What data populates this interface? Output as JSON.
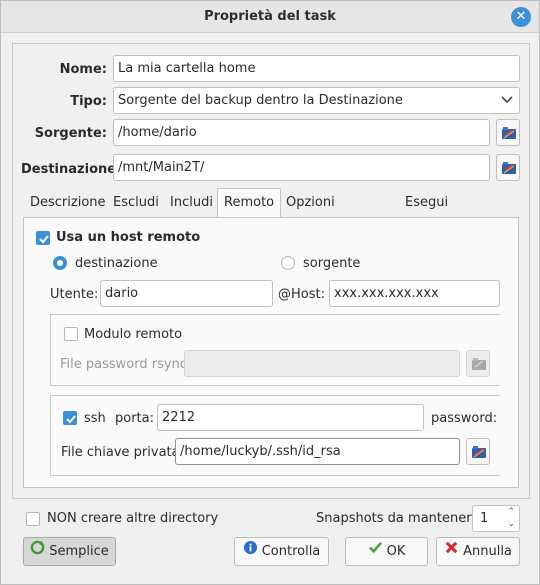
{
  "window": {
    "title": "Proprietà del task"
  },
  "form": {
    "name_label": "Nome:",
    "name_value": "La mia cartella home",
    "type_label": "Tipo:",
    "type_value": "Sorgente del backup dentro la Destinazione",
    "source_label": "Sorgente:",
    "source_value": "/home/dario",
    "dest_label": "Destinazione:",
    "dest_value": "/mnt/Main2T/"
  },
  "tabs": [
    {
      "label": "Descrizione",
      "active": false
    },
    {
      "label": "Escludi",
      "active": false
    },
    {
      "label": "Includi",
      "active": false
    },
    {
      "label": "Remoto",
      "active": true
    },
    {
      "label": "Opzioni comando",
      "active": false
    },
    {
      "label": "Esegui comandi",
      "active": false
    }
  ],
  "remote": {
    "use_remote_label": "Usa un host remoto",
    "use_remote_checked": true,
    "dest_radio_label": "destinazione",
    "source_radio_label": "sorgente",
    "selected_radio": "destinazione",
    "user_label": "Utente:",
    "user_value": "dario",
    "host_label": "@Host:",
    "host_value": "xxx.xxx.xxx.xxx",
    "module_label": "Modulo remoto",
    "module_checked": false,
    "rsync_pw_label": "File password rsync:",
    "rsync_pw_value": "",
    "ssh_label": "ssh",
    "ssh_checked": true,
    "port_label": "porta:",
    "port_value": "2212",
    "password_label": "password:",
    "key_label": "File chiave privata:",
    "key_value": "/home/luckyb/.ssh/id_rsa"
  },
  "footer": {
    "no_create_label": "NON creare altre directory",
    "no_create_checked": false,
    "snapshots_label": "Snapshots da mantenere:",
    "snapshots_value": "1"
  },
  "buttons": {
    "simple": "Semplice",
    "check": "Controlla",
    "ok": "OK",
    "cancel": "Annulla"
  },
  "colors": {
    "accent": "#3d8fd6",
    "cancel_icon": "#d22b2b",
    "ok_icon": "#4aa33a"
  }
}
